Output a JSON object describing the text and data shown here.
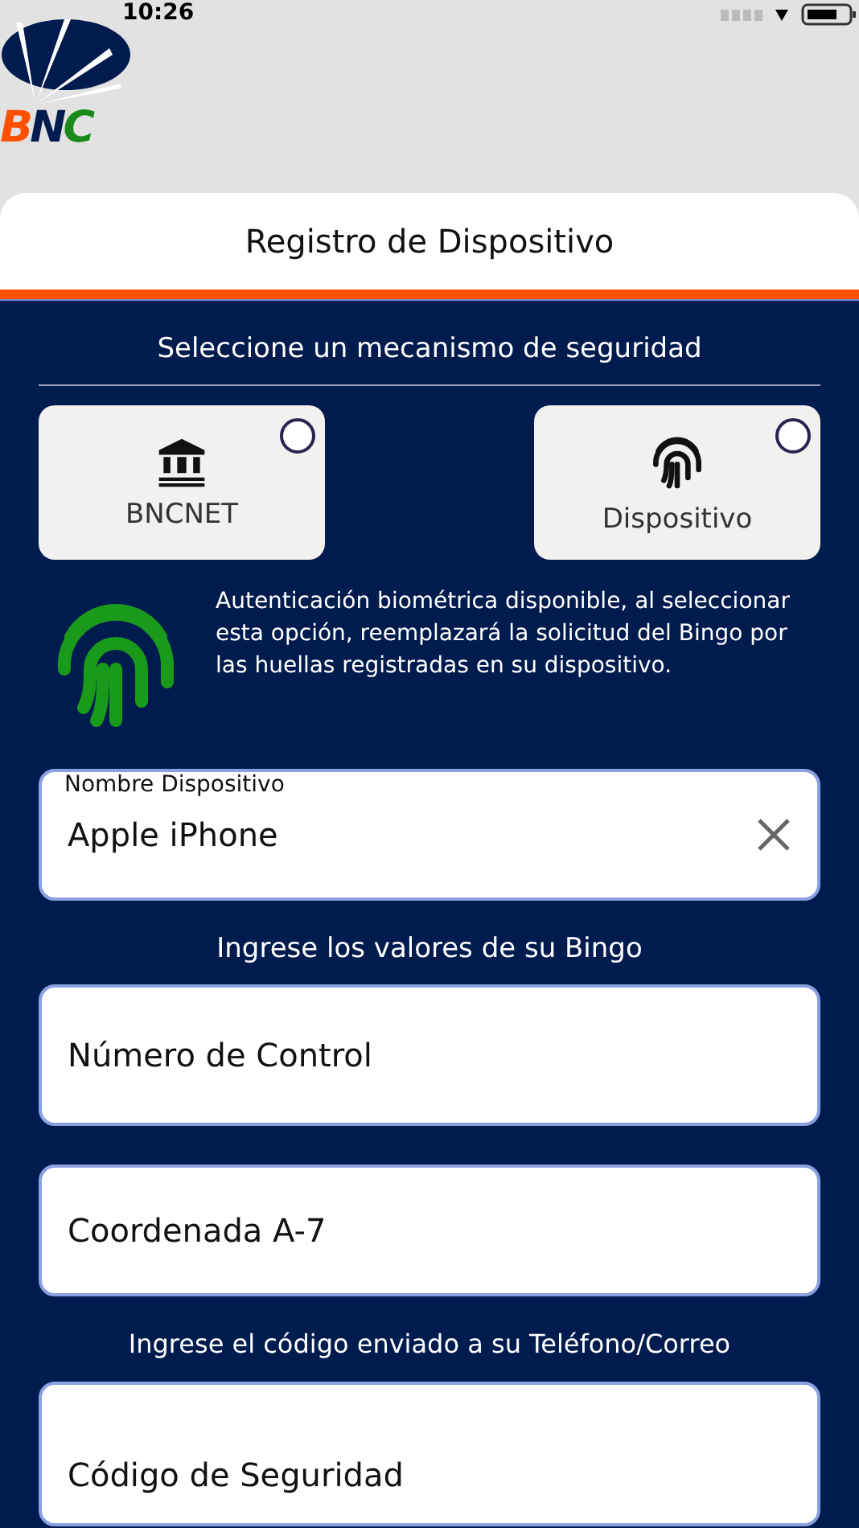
{
  "status_bar": {
    "time": "10:26"
  },
  "header": {
    "logo_text": "BNC"
  },
  "card": {
    "title": "Registro de Dispositivo"
  },
  "security": {
    "heading": "Seleccione un mecanismo de seguridad",
    "options": [
      {
        "kind": "bank",
        "label": "BNCNET",
        "selected": false
      },
      {
        "kind": "fingerprint",
        "label": "Dispositivo",
        "selected": false
      }
    ],
    "biometric_note": "Autenticación biométrica disponible, al seleccionar esta opción, reemplazará la solicitud del Bingo por las huellas registradas en su dispositivo."
  },
  "device_field": {
    "label": "Nombre Dispositivo",
    "value": "Apple iPhone"
  },
  "bingo": {
    "heading": "Ingrese los valores de su Bingo",
    "fields": [
      {
        "placeholder": "Número de Control"
      },
      {
        "placeholder": "Coordenada A-7"
      }
    ]
  },
  "code": {
    "heading": "Ingrese el código enviado a su Teléfono/Correo",
    "field": {
      "placeholder": "Código de Seguridad"
    }
  }
}
